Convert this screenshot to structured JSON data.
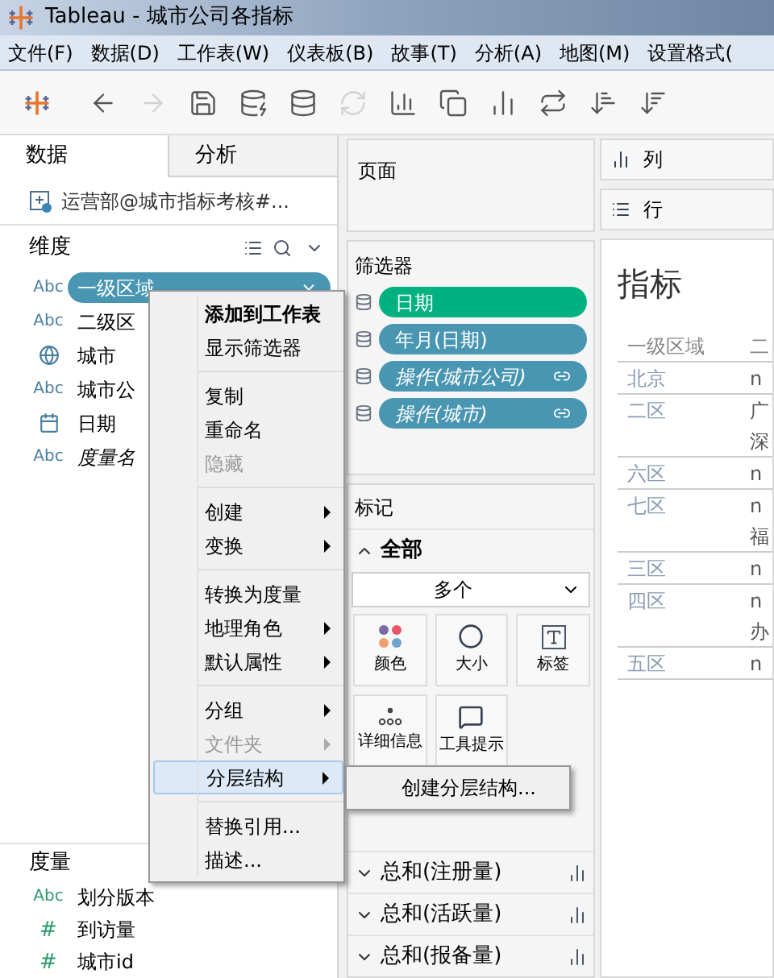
{
  "window": {
    "title": "Tableau - 城市公司各指标"
  },
  "menu_bar": [
    "文件(F)",
    "数据(D)",
    "工作表(W)",
    "仪表板(B)",
    "故事(T)",
    "分析(A)",
    "地图(M)",
    "设置格式("
  ],
  "toolbar": [
    {
      "kind": "logo",
      "disabled": false
    },
    {
      "kind": "back",
      "disabled": false
    },
    {
      "kind": "forward",
      "disabled": true
    },
    {
      "kind": "save",
      "disabled": false
    },
    {
      "kind": "new_datasource",
      "disabled": false
    },
    {
      "kind": "pause",
      "disabled": false
    },
    {
      "kind": "refresh",
      "disabled": true
    },
    {
      "kind": "new_sheet",
      "disabled": false
    },
    {
      "kind": "duplicate",
      "disabled": false
    },
    {
      "kind": "clear",
      "disabled": false
    },
    {
      "kind": "swap",
      "disabled": false
    },
    {
      "kind": "sort_asc",
      "disabled": false
    },
    {
      "kind": "sort_desc",
      "disabled": false
    }
  ],
  "side_tabs": [
    {
      "label": "数据",
      "selected": true
    },
    {
      "label": "分析",
      "selected": false
    }
  ],
  "datasource": "运营部@城市指标考核#...",
  "dimensions": {
    "title": "维度",
    "items": [
      {
        "label": "一级区域",
        "kind": "text",
        "icon": "Abc",
        "selected": true
      },
      {
        "label": "二级区",
        "kind": "text",
        "icon": "Abc",
        "selected": false
      },
      {
        "label": "城市",
        "kind": "geo",
        "selected": false
      },
      {
        "label": "城市公",
        "kind": "text",
        "icon": "Abc",
        "selected": false
      },
      {
        "label": "日期",
        "kind": "date",
        "selected": false
      },
      {
        "label": "度量名",
        "kind": "virtual",
        "icon": "Abc",
        "selected": false
      }
    ]
  },
  "measures": {
    "title": "度量",
    "items": [
      {
        "label": "划分版本",
        "kind": "text",
        "icon": "Abc"
      },
      {
        "label": "到访量",
        "kind": "number",
        "icon": "#"
      },
      {
        "label": "城市id",
        "kind": "number",
        "icon": "#"
      }
    ]
  },
  "context_menu": [
    [
      {
        "label": "添加到工作表",
        "default": true,
        "disabled": false,
        "submenu": false,
        "selected": false
      },
      {
        "label": "显示筛选器",
        "default": false,
        "disabled": false,
        "submenu": false,
        "selected": false
      }
    ],
    [
      {
        "label": "复制",
        "default": false,
        "disabled": false,
        "submenu": false,
        "selected": false
      },
      {
        "label": "重命名",
        "default": false,
        "disabled": false,
        "submenu": false,
        "selected": false
      },
      {
        "label": "隐藏",
        "default": false,
        "disabled": true,
        "submenu": false,
        "selected": false
      }
    ],
    [
      {
        "label": "创建",
        "default": false,
        "disabled": false,
        "submenu": true,
        "selected": false
      },
      {
        "label": "变换",
        "default": false,
        "disabled": false,
        "submenu": true,
        "selected": false
      }
    ],
    [
      {
        "label": "转换为度量",
        "default": false,
        "disabled": false,
        "submenu": false,
        "selected": false
      },
      {
        "label": "地理角色",
        "default": false,
        "disabled": false,
        "submenu": true,
        "selected": false
      },
      {
        "label": "默认属性",
        "default": false,
        "disabled": false,
        "submenu": true,
        "selected": false
      }
    ],
    [
      {
        "label": "分组",
        "default": false,
        "disabled": false,
        "submenu": true,
        "selected": false
      },
      {
        "label": "文件夹",
        "default": false,
        "disabled": true,
        "submenu": true,
        "selected": false
      },
      {
        "label": "分层结构",
        "default": false,
        "disabled": false,
        "submenu": true,
        "selected": true
      }
    ],
    [
      {
        "label": "替换引用...",
        "default": false,
        "disabled": false,
        "submenu": false,
        "selected": false
      },
      {
        "label": "描述...",
        "default": false,
        "disabled": false,
        "submenu": false,
        "selected": false
      }
    ]
  ],
  "submenu": [
    "创建分层结构..."
  ],
  "pages": {
    "title": "页面"
  },
  "filters": {
    "title": "筛选器",
    "items": [
      {
        "label": "日期",
        "kind": "field",
        "color": "#00b180"
      },
      {
        "label": "年月(日期)",
        "kind": "field",
        "color": "#4996b2"
      },
      {
        "label": "操作(城市公司)",
        "kind": "action",
        "color": "#4996b2"
      },
      {
        "label": "操作(城市)",
        "kind": "action",
        "color": "#4996b2"
      }
    ]
  },
  "marks": {
    "title": "标记",
    "group": "全部",
    "expanded": true,
    "mark_type": "多个",
    "buttons": [
      {
        "label": "颜色",
        "kind": "color"
      },
      {
        "label": "大小",
        "kind": "size"
      },
      {
        "label": "标签",
        "kind": "label"
      },
      {
        "label": "详细信息",
        "kind": "detail"
      },
      {
        "label": "工具提示",
        "kind": "tooltip"
      }
    ],
    "fields": [
      {
        "label": "总和(注册量)",
        "expanded": false
      },
      {
        "label": "总和(活跃量)",
        "expanded": false
      },
      {
        "label": "总和(报备量)",
        "expanded": false
      }
    ]
  },
  "columns_shelf": "列",
  "rows_shelf": "行",
  "sheet": {
    "title": "指标",
    "columns": [
      "一级区域",
      "二"
    ],
    "rows": [
      {
        "column_1": "北京",
        "column_2": [
          "n"
        ]
      },
      {
        "column_1": "二区",
        "column_2": [
          "广",
          "深"
        ]
      },
      {
        "column_1": "六区",
        "column_2": [
          "n"
        ]
      },
      {
        "column_1": "七区",
        "column_2": [
          "n",
          "福"
        ]
      },
      {
        "column_1": "三区",
        "column_2": [
          "n"
        ]
      },
      {
        "column_1": "四区",
        "column_2": [
          "n",
          "办"
        ]
      },
      {
        "column_1": "五区",
        "column_2": [
          "n"
        ]
      }
    ]
  }
}
